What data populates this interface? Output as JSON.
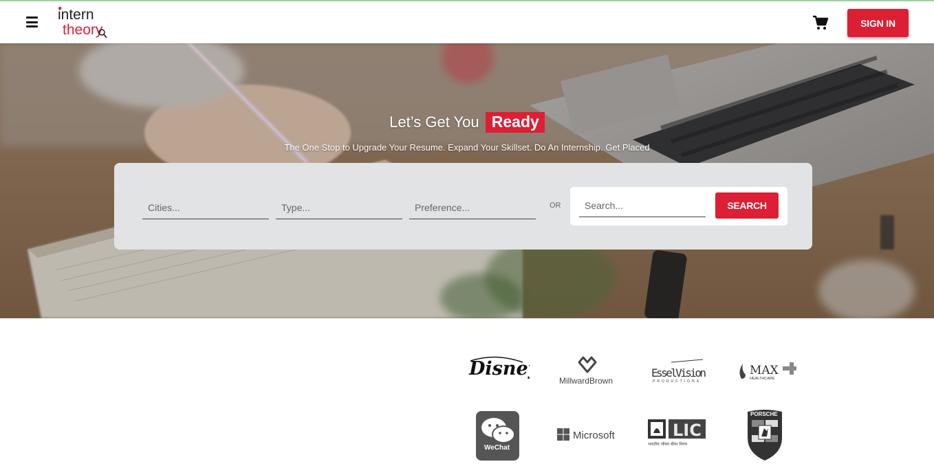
{
  "header": {
    "logo_text_line1": "intern",
    "logo_text_line2": "theory",
    "sign_in_label": "SIGN IN"
  },
  "hero": {
    "title_lead": "Let’s Get You",
    "title_highlight": "Ready",
    "subtitle": "The One Stop to Upgrade Your Resume. Expand Your Skillset. Do An Internship. Get Placed"
  },
  "search": {
    "cities_placeholder": "Cities...",
    "type_placeholder": "Type...",
    "preference_placeholder": "Preference...",
    "or_label": "OR",
    "query_placeholder": "Search...",
    "search_button": "SEARCH"
  },
  "partners": {
    "disney": "Disney",
    "millward": "MillwardBrown",
    "essel_main": "EsselVision",
    "essel_sub": "PRODUCTIONS",
    "max_main": "MAX",
    "max_sub": "HEALTHCARE",
    "wechat": "WeChat",
    "microsoft": "Microsoft",
    "lic": "LIC",
    "lic_sub": "भारतीय जीवन बीमा निगम",
    "porsche": "PORSCHE"
  },
  "colors": {
    "brand_red": "#dc1f34",
    "panel_grey": "#e2e3e4"
  },
  "icons": [
    "hamburger-icon",
    "cart-icon"
  ]
}
